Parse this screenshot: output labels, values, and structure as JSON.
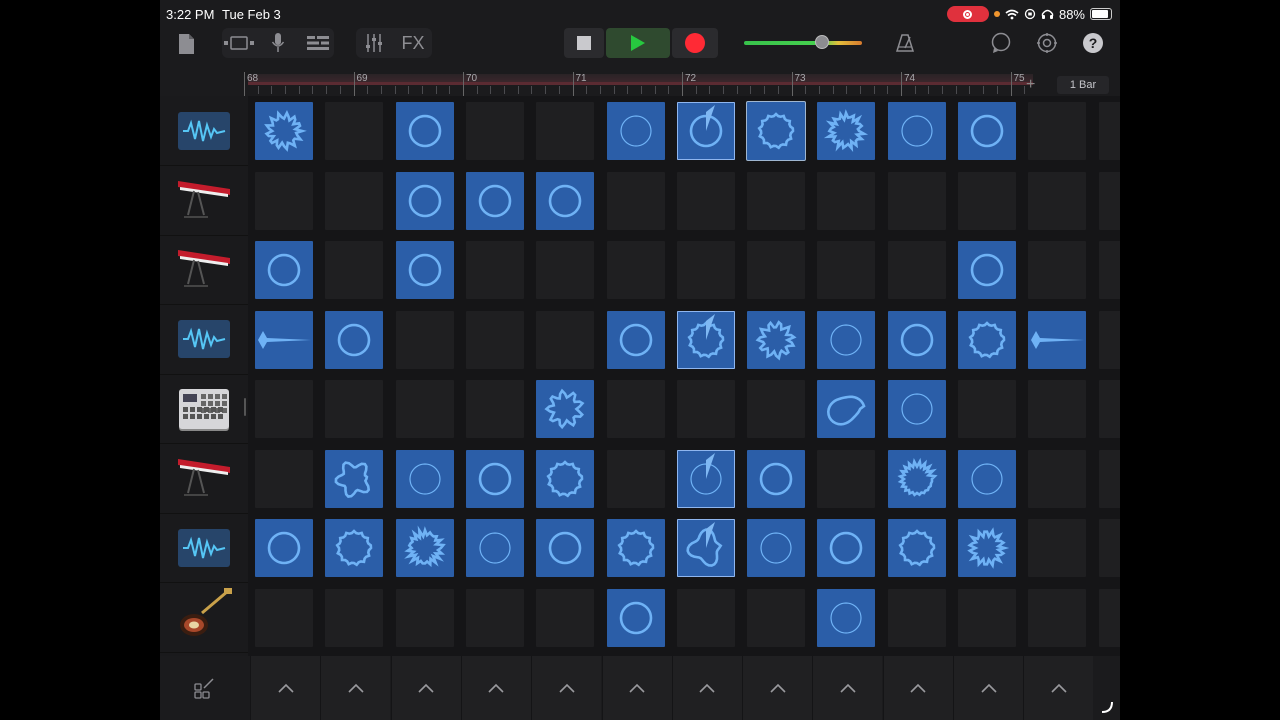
{
  "status_bar": {
    "time": "3:22 PM",
    "date": "Tue Feb 3",
    "battery": "88%",
    "battery_level": 0.88
  },
  "toolbar": {
    "fx_label": "FX",
    "icons": [
      "file-icon",
      "view-toggle-icon",
      "mic-icon",
      "tracks-icon",
      "mixer-icon",
      "stop-icon",
      "play-icon",
      "record-icon",
      "volume-slider",
      "metronome-icon",
      "loop-icon",
      "settings-icon",
      "help-icon"
    ],
    "volume_level": 0.66,
    "colors": {
      "play": "#27c93f",
      "record": "#ff2a35",
      "accent": "#2b5ea8"
    }
  },
  "ruler": {
    "bars": [
      "68",
      "69",
      "70",
      "71",
      "72",
      "73",
      "74",
      "75"
    ],
    "length_label": "1 Bar"
  },
  "tracks": [
    {
      "name": "sampler",
      "icon": "waveform-icon",
      "cells": [
        1,
        0,
        1,
        0,
        0,
        1,
        1,
        1,
        1,
        1,
        1,
        0,
        0
      ]
    },
    {
      "name": "keyboard",
      "icon": "keyboard-icon",
      "cells": [
        0,
        0,
        1,
        1,
        1,
        0,
        0,
        0,
        0,
        0,
        0,
        0,
        0
      ]
    },
    {
      "name": "keyboard",
      "icon": "keyboard-icon",
      "cells": [
        1,
        0,
        1,
        0,
        0,
        0,
        0,
        0,
        0,
        0,
        1,
        0,
        0
      ]
    },
    {
      "name": "sampler",
      "icon": "waveform-icon",
      "cells": [
        1,
        1,
        0,
        0,
        0,
        1,
        1,
        1,
        1,
        1,
        1,
        1,
        0
      ]
    },
    {
      "name": "drum-machine",
      "icon": "drum-machine-icon",
      "cells": [
        0,
        0,
        0,
        0,
        1,
        0,
        0,
        0,
        1,
        1,
        0,
        0,
        0
      ]
    },
    {
      "name": "keyboard",
      "icon": "keyboard-icon",
      "cells": [
        0,
        1,
        1,
        1,
        1,
        0,
        1,
        1,
        0,
        1,
        1,
        0,
        0
      ]
    },
    {
      "name": "sampler",
      "icon": "waveform-icon",
      "cells": [
        1,
        1,
        1,
        1,
        1,
        1,
        1,
        1,
        1,
        1,
        1,
        0,
        0
      ]
    },
    {
      "name": "guitar",
      "icon": "guitar-icon",
      "cells": [
        0,
        0,
        0,
        0,
        0,
        1,
        0,
        0,
        1,
        0,
        0,
        0,
        0
      ]
    }
  ],
  "playing_column": 6,
  "trigger_icon": "chevron-up-icon",
  "edit_icon": "edit-cells-icon"
}
